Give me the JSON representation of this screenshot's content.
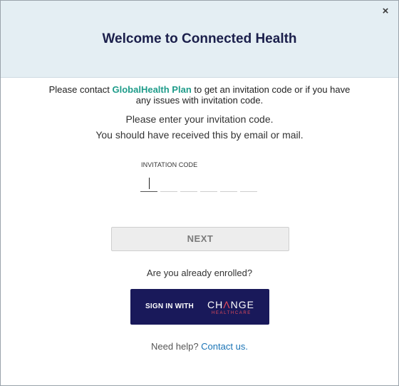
{
  "header": {
    "title": "Welcome to Connected Health",
    "close_label": "×"
  },
  "contact": {
    "prefix": "Please contact ",
    "plan_name": "GlobalHealth Plan",
    "suffix": " to get an invitation code or if you have any issues with invitation code."
  },
  "instructions": {
    "line1": "Please enter your invitation code.",
    "line2": "You should have received this by email or mail."
  },
  "invitation": {
    "label": "INVITATION CODE",
    "digits": [
      "",
      "",
      "",
      "",
      "",
      ""
    ]
  },
  "next_button": {
    "label": "NEXT"
  },
  "enrolled": {
    "text": "Are you already enrolled?"
  },
  "signin_button": {
    "label": "SIGN IN WITH",
    "brand_prefix": "CH",
    "brand_a": "Λ",
    "brand_suffix": "NGE",
    "brand_sub": "HEALTHCARE"
  },
  "help": {
    "text": "Need help? ",
    "link": "Contact us."
  },
  "colors": {
    "header_bg": "#e4eef3",
    "title": "#1b1f4b",
    "plan_link": "#1f9c8a",
    "signin_bg": "#19195a",
    "brand_accent": "#e24b5a",
    "help_link": "#1a74b6"
  }
}
